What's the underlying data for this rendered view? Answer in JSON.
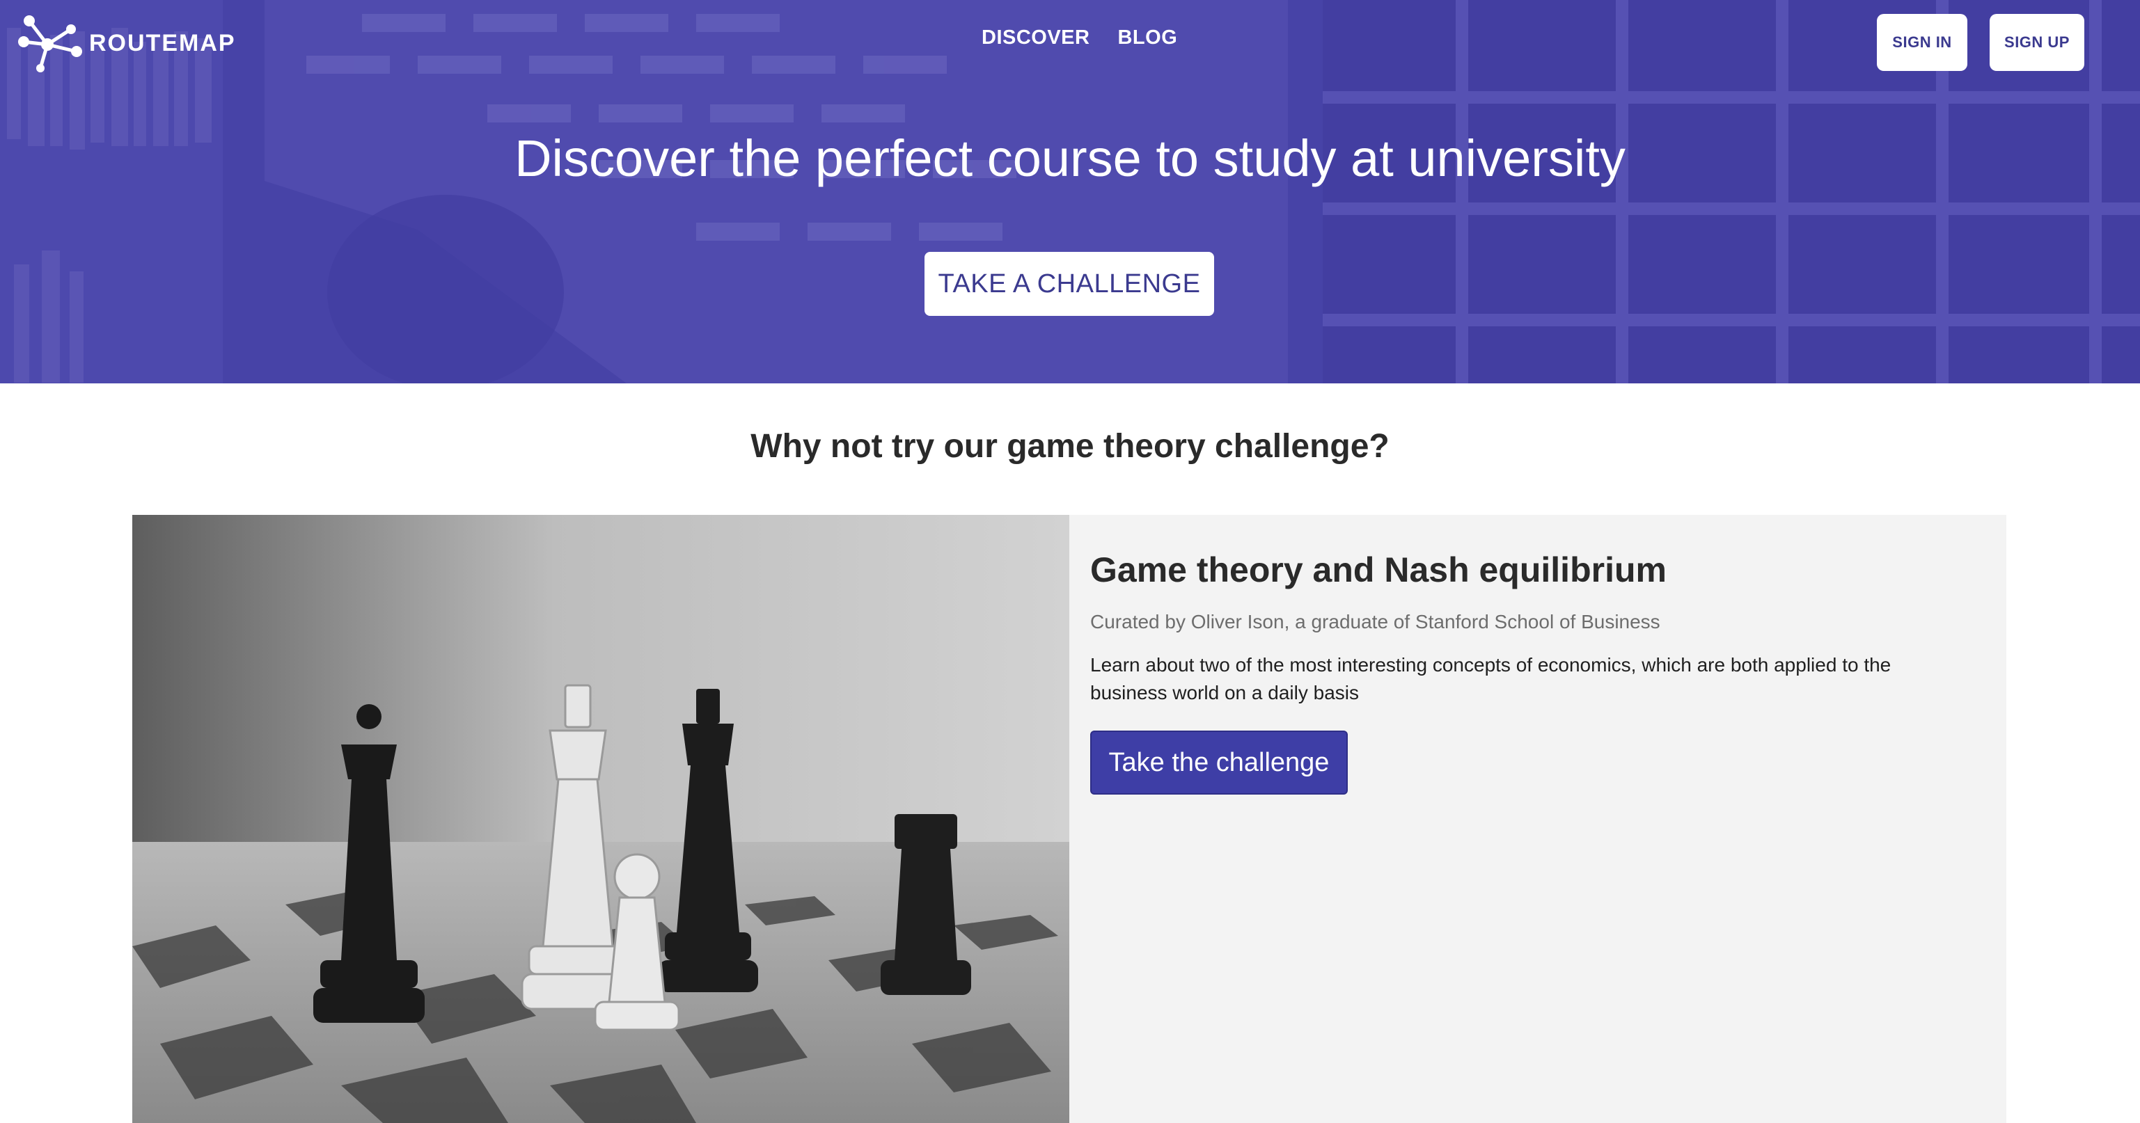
{
  "brand": {
    "name": "ROUTEMAP"
  },
  "nav": {
    "items": [
      "DISCOVER",
      "BLOG"
    ]
  },
  "auth": {
    "sign_in": "SIGN IN",
    "sign_up": "SIGN UP"
  },
  "hero": {
    "title": "Discover the perfect course to study at university",
    "cta": "TAKE A CHALLENGE"
  },
  "section": {
    "title": "Why not try our game theory challenge?"
  },
  "card": {
    "title": "Game theory and Nash equilibrium",
    "curator": "Curated by Oliver Ison, a graduate of Stanford School of Business",
    "description": "Learn about two of the most interesting concepts of economics, which are both applied to the business world on a daily basis",
    "cta": "Take the challenge",
    "image_icon": "chess-pieces-photo"
  },
  "colors": {
    "brand": "#4c48a6",
    "cta_dark": "#3e3ea6",
    "card_bg": "#f3f3f3"
  }
}
